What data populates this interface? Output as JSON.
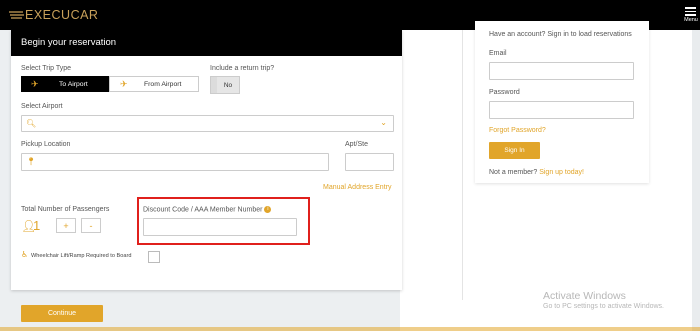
{
  "header": {
    "logo_text": "EXECUCAR",
    "menu_label": "Menu"
  },
  "reservation": {
    "title": "Begin your reservation",
    "trip_type_label": "Select Trip Type",
    "to_airport": "To Airport",
    "from_airport": "From Airport",
    "return_label": "Include a return trip?",
    "return_value": "No",
    "airport_label": "Select Airport",
    "airport_value": "",
    "pickup_label": "Pickup Location",
    "pickup_value": "",
    "apt_label": "Apt/Ste",
    "apt_value": "",
    "manual_entry": "Manual Address Entry",
    "passengers_label": "Total Number of Passengers",
    "passenger_count": "1",
    "plus": "+",
    "minus": "-",
    "discount_label": "Discount Code / AAA Member Number",
    "discount_value": "",
    "wheelchair_label": "Wheelchair Lift/Ramp Required to Board",
    "continue": "Continue"
  },
  "login": {
    "prompt": "Have an account? Sign in to load reservations",
    "email_label": "Email",
    "email_value": "",
    "password_label": "Password",
    "password_value": "",
    "forgot": "Forgot Password?",
    "signin": "Sign In",
    "not_member": "Not a member?",
    "signup": "Sign up today!"
  },
  "watermark": {
    "title": "Activate Windows",
    "subtitle": "Go to PC settings to activate Windows."
  },
  "colors": {
    "accent": "#e1a52a",
    "highlight": "#e0201c",
    "header_bg": "#000000"
  }
}
